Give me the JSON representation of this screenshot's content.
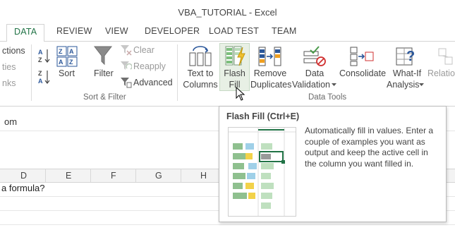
{
  "window": {
    "title": "VBA_TUTORIAL - Excel"
  },
  "tabs": [
    {
      "label": "DATA",
      "active": true
    },
    {
      "label": "REVIEW"
    },
    {
      "label": "VIEW"
    },
    {
      "label": "DEVELOPER"
    },
    {
      "label": "LOAD TEST"
    },
    {
      "label": "TEAM"
    }
  ],
  "ribbon": {
    "connections_partial": {
      "connections": "ctions",
      "properties": "ties",
      "edit_links": "nks"
    },
    "sort_filter": {
      "sort": "Sort",
      "filter": "Filter",
      "clear": "Clear",
      "reapply": "Reapply",
      "advanced": "Advanced",
      "group_label": "Sort & Filter"
    },
    "data_tools": {
      "text_to_columns_1": "Text to",
      "text_to_columns_2": "Columns",
      "flash_fill_1": "Flash",
      "flash_fill_2": "Fill",
      "remove_duplicates_1": "Remove",
      "remove_duplicates_2": "Duplicates",
      "data_validation_1": "Data",
      "data_validation_2": "Validation",
      "consolidate": "Consolidate",
      "what_if_1": "What-If",
      "what_if_2": "Analysis",
      "relationships_partial": "Relation",
      "group_label": "Data Tools"
    }
  },
  "sheet": {
    "formula_bar_text": "om",
    "columns": [
      "D",
      "E",
      "F",
      "G",
      "H"
    ],
    "cell_text": "a formula?"
  },
  "tooltip": {
    "title": "Flash Fill (Ctrl+E)",
    "description": "Automatically fill in values. Enter a couple of examples you want as output and keep the active cell in the column you want filled in."
  },
  "colors": {
    "accent": "#217346",
    "flash_fill_highlight": "#e8f0e5"
  }
}
